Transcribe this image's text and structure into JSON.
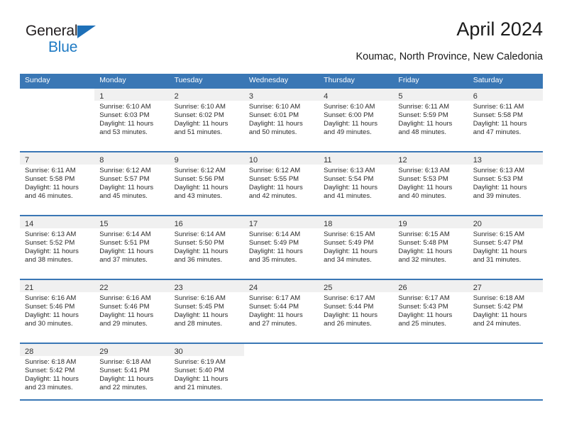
{
  "brand": {
    "name_dark": "General",
    "name_light": "Blue",
    "accent_color": "#1e7ac4",
    "triangle_color": "#1e70b8"
  },
  "header": {
    "title": "April 2024",
    "subtitle": "Koumac, North Province, New Caledonia"
  },
  "calendar": {
    "header_color": "#3a77b5",
    "daynum_band_color": "#f0f0f0",
    "weekdays": [
      "Sunday",
      "Monday",
      "Tuesday",
      "Wednesday",
      "Thursday",
      "Friday",
      "Saturday"
    ],
    "weeks": [
      [
        {
          "day": "",
          "sunrise": "",
          "sunset": "",
          "daylight1": "",
          "daylight2": ""
        },
        {
          "day": "1",
          "sunrise": "Sunrise: 6:10 AM",
          "sunset": "Sunset: 6:03 PM",
          "daylight1": "Daylight: 11 hours",
          "daylight2": "and 53 minutes."
        },
        {
          "day": "2",
          "sunrise": "Sunrise: 6:10 AM",
          "sunset": "Sunset: 6:02 PM",
          "daylight1": "Daylight: 11 hours",
          "daylight2": "and 51 minutes."
        },
        {
          "day": "3",
          "sunrise": "Sunrise: 6:10 AM",
          "sunset": "Sunset: 6:01 PM",
          "daylight1": "Daylight: 11 hours",
          "daylight2": "and 50 minutes."
        },
        {
          "day": "4",
          "sunrise": "Sunrise: 6:10 AM",
          "sunset": "Sunset: 6:00 PM",
          "daylight1": "Daylight: 11 hours",
          "daylight2": "and 49 minutes."
        },
        {
          "day": "5",
          "sunrise": "Sunrise: 6:11 AM",
          "sunset": "Sunset: 5:59 PM",
          "daylight1": "Daylight: 11 hours",
          "daylight2": "and 48 minutes."
        },
        {
          "day": "6",
          "sunrise": "Sunrise: 6:11 AM",
          "sunset": "Sunset: 5:58 PM",
          "daylight1": "Daylight: 11 hours",
          "daylight2": "and 47 minutes."
        }
      ],
      [
        {
          "day": "7",
          "sunrise": "Sunrise: 6:11 AM",
          "sunset": "Sunset: 5:58 PM",
          "daylight1": "Daylight: 11 hours",
          "daylight2": "and 46 minutes."
        },
        {
          "day": "8",
          "sunrise": "Sunrise: 6:12 AM",
          "sunset": "Sunset: 5:57 PM",
          "daylight1": "Daylight: 11 hours",
          "daylight2": "and 45 minutes."
        },
        {
          "day": "9",
          "sunrise": "Sunrise: 6:12 AM",
          "sunset": "Sunset: 5:56 PM",
          "daylight1": "Daylight: 11 hours",
          "daylight2": "and 43 minutes."
        },
        {
          "day": "10",
          "sunrise": "Sunrise: 6:12 AM",
          "sunset": "Sunset: 5:55 PM",
          "daylight1": "Daylight: 11 hours",
          "daylight2": "and 42 minutes."
        },
        {
          "day": "11",
          "sunrise": "Sunrise: 6:13 AM",
          "sunset": "Sunset: 5:54 PM",
          "daylight1": "Daylight: 11 hours",
          "daylight2": "and 41 minutes."
        },
        {
          "day": "12",
          "sunrise": "Sunrise: 6:13 AM",
          "sunset": "Sunset: 5:53 PM",
          "daylight1": "Daylight: 11 hours",
          "daylight2": "and 40 minutes."
        },
        {
          "day": "13",
          "sunrise": "Sunrise: 6:13 AM",
          "sunset": "Sunset: 5:53 PM",
          "daylight1": "Daylight: 11 hours",
          "daylight2": "and 39 minutes."
        }
      ],
      [
        {
          "day": "14",
          "sunrise": "Sunrise: 6:13 AM",
          "sunset": "Sunset: 5:52 PM",
          "daylight1": "Daylight: 11 hours",
          "daylight2": "and 38 minutes."
        },
        {
          "day": "15",
          "sunrise": "Sunrise: 6:14 AM",
          "sunset": "Sunset: 5:51 PM",
          "daylight1": "Daylight: 11 hours",
          "daylight2": "and 37 minutes."
        },
        {
          "day": "16",
          "sunrise": "Sunrise: 6:14 AM",
          "sunset": "Sunset: 5:50 PM",
          "daylight1": "Daylight: 11 hours",
          "daylight2": "and 36 minutes."
        },
        {
          "day": "17",
          "sunrise": "Sunrise: 6:14 AM",
          "sunset": "Sunset: 5:49 PM",
          "daylight1": "Daylight: 11 hours",
          "daylight2": "and 35 minutes."
        },
        {
          "day": "18",
          "sunrise": "Sunrise: 6:15 AM",
          "sunset": "Sunset: 5:49 PM",
          "daylight1": "Daylight: 11 hours",
          "daylight2": "and 34 minutes."
        },
        {
          "day": "19",
          "sunrise": "Sunrise: 6:15 AM",
          "sunset": "Sunset: 5:48 PM",
          "daylight1": "Daylight: 11 hours",
          "daylight2": "and 32 minutes."
        },
        {
          "day": "20",
          "sunrise": "Sunrise: 6:15 AM",
          "sunset": "Sunset: 5:47 PM",
          "daylight1": "Daylight: 11 hours",
          "daylight2": "and 31 minutes."
        }
      ],
      [
        {
          "day": "21",
          "sunrise": "Sunrise: 6:16 AM",
          "sunset": "Sunset: 5:46 PM",
          "daylight1": "Daylight: 11 hours",
          "daylight2": "and 30 minutes."
        },
        {
          "day": "22",
          "sunrise": "Sunrise: 6:16 AM",
          "sunset": "Sunset: 5:46 PM",
          "daylight1": "Daylight: 11 hours",
          "daylight2": "and 29 minutes."
        },
        {
          "day": "23",
          "sunrise": "Sunrise: 6:16 AM",
          "sunset": "Sunset: 5:45 PM",
          "daylight1": "Daylight: 11 hours",
          "daylight2": "and 28 minutes."
        },
        {
          "day": "24",
          "sunrise": "Sunrise: 6:17 AM",
          "sunset": "Sunset: 5:44 PM",
          "daylight1": "Daylight: 11 hours",
          "daylight2": "and 27 minutes."
        },
        {
          "day": "25",
          "sunrise": "Sunrise: 6:17 AM",
          "sunset": "Sunset: 5:44 PM",
          "daylight1": "Daylight: 11 hours",
          "daylight2": "and 26 minutes."
        },
        {
          "day": "26",
          "sunrise": "Sunrise: 6:17 AM",
          "sunset": "Sunset: 5:43 PM",
          "daylight1": "Daylight: 11 hours",
          "daylight2": "and 25 minutes."
        },
        {
          "day": "27",
          "sunrise": "Sunrise: 6:18 AM",
          "sunset": "Sunset: 5:42 PM",
          "daylight1": "Daylight: 11 hours",
          "daylight2": "and 24 minutes."
        }
      ],
      [
        {
          "day": "28",
          "sunrise": "Sunrise: 6:18 AM",
          "sunset": "Sunset: 5:42 PM",
          "daylight1": "Daylight: 11 hours",
          "daylight2": "and 23 minutes."
        },
        {
          "day": "29",
          "sunrise": "Sunrise: 6:18 AM",
          "sunset": "Sunset: 5:41 PM",
          "daylight1": "Daylight: 11 hours",
          "daylight2": "and 22 minutes."
        },
        {
          "day": "30",
          "sunrise": "Sunrise: 6:19 AM",
          "sunset": "Sunset: 5:40 PM",
          "daylight1": "Daylight: 11 hours",
          "daylight2": "and 21 minutes."
        },
        {
          "day": "",
          "sunrise": "",
          "sunset": "",
          "daylight1": "",
          "daylight2": ""
        },
        {
          "day": "",
          "sunrise": "",
          "sunset": "",
          "daylight1": "",
          "daylight2": ""
        },
        {
          "day": "",
          "sunrise": "",
          "sunset": "",
          "daylight1": "",
          "daylight2": ""
        },
        {
          "day": "",
          "sunrise": "",
          "sunset": "",
          "daylight1": "",
          "daylight2": ""
        }
      ]
    ]
  }
}
